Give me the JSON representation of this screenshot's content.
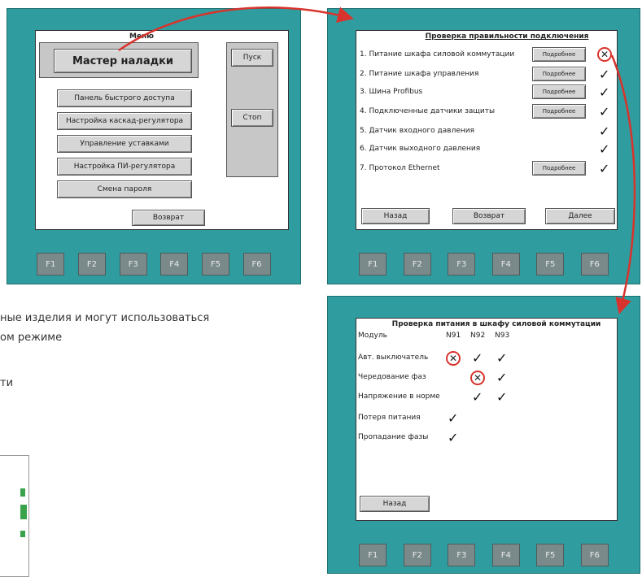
{
  "fkeys": [
    "F1",
    "F2",
    "F3",
    "F4",
    "F5",
    "F6"
  ],
  "panel1": {
    "menu_title": "Меню",
    "wizard_button": "Мастер наладки",
    "start_button": "Пуск",
    "stop_button": "Стоп",
    "menu_items": [
      "Панель быстрого доступа",
      "Настройка каскад-регулятора",
      "Управление уставками",
      "Настройка ПИ-регулятора",
      "Смена пароля"
    ],
    "return_button": "Возврат"
  },
  "panel2": {
    "title": "Проверка правильности подключения",
    "rows": [
      {
        "label": "1. Питание шкафа силовой коммутации",
        "has_details": true,
        "status": "fail"
      },
      {
        "label": "2. Питание шкафа управления",
        "has_details": true,
        "status": "ok"
      },
      {
        "label": "3. Шина Profibus",
        "has_details": true,
        "status": "ok"
      },
      {
        "label": "4. Подключенные датчики защиты",
        "has_details": true,
        "status": "ok"
      },
      {
        "label": "5. Датчик входного давления",
        "has_details": false,
        "status": "ok"
      },
      {
        "label": "6. Датчик выходного давления",
        "has_details": false,
        "status": "ok"
      },
      {
        "label": "7. Протокол Ethernet",
        "has_details": true,
        "status": "ok"
      }
    ],
    "details_label": "Подробнее",
    "back_button": "Назад",
    "return_button": "Возврат",
    "next_button": "Далее"
  },
  "panel3": {
    "title": "Проверка питания в шкафу силовой коммутации",
    "module_label": "Модуль",
    "columns": [
      "N91",
      "N92",
      "N93"
    ],
    "rows": [
      {
        "label": "Авт. выключатель",
        "cells": [
          "fail",
          "ok",
          "ok"
        ]
      },
      {
        "label": "Чередование фаз",
        "cells": [
          "",
          "fail",
          "ok"
        ]
      },
      {
        "label": "Напряжение в норме",
        "cells": [
          "",
          "ok",
          "ok"
        ]
      },
      {
        "label": "Потеря питания",
        "cells": [
          "ok",
          "",
          ""
        ]
      },
      {
        "label": "Пропадание фазы",
        "cells": [
          "ok",
          "",
          ""
        ]
      }
    ],
    "back_button": "Назад"
  },
  "background_text": {
    "line1": "ные изделия и могут использоваться",
    "line2": "ом режиме",
    "line3": "ти"
  },
  "colors": {
    "panel": "#2f9da0",
    "fkey": "#7a8a8a",
    "button": "#d6d6d6",
    "arrow": "#d8332c"
  },
  "icons": {
    "ok": "✓",
    "fail": "✕"
  }
}
